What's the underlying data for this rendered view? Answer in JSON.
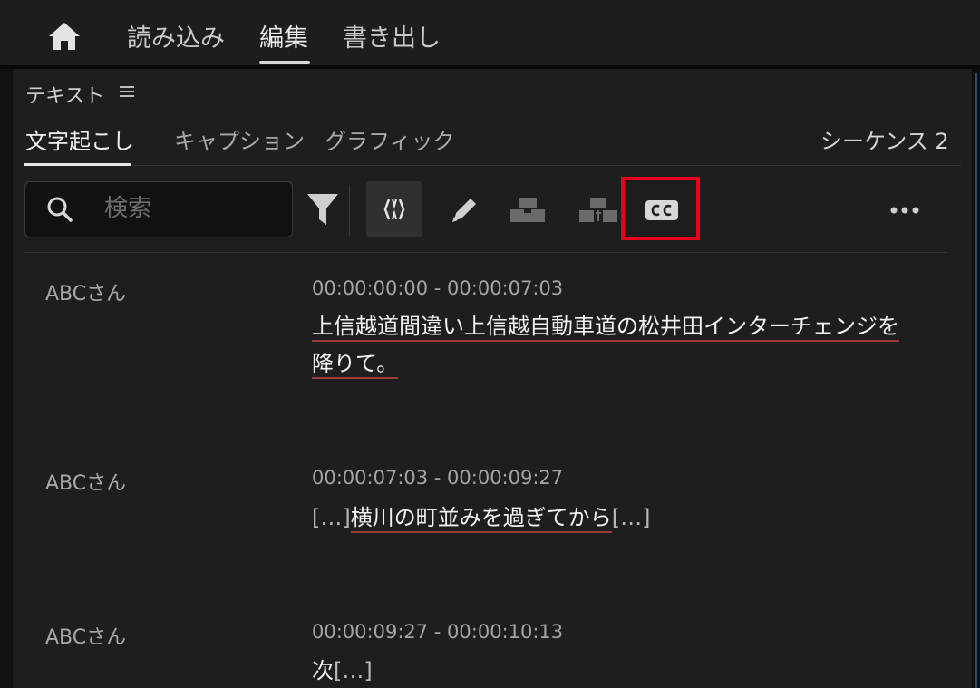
{
  "nav": {
    "home_icon": "home-icon",
    "tabs": [
      {
        "label": "読み込み",
        "active": false
      },
      {
        "label": "編集",
        "active": true
      },
      {
        "label": "書き出し",
        "active": false
      }
    ]
  },
  "panel": {
    "title": "テキスト",
    "menu_icon": "hamburger-icon",
    "tabs": [
      {
        "label": "文字起こし",
        "active": true
      },
      {
        "label": "キャプション",
        "active": false
      },
      {
        "label": "グラフィック",
        "active": false
      }
    ],
    "sequence": "シーケンス 2"
  },
  "toolbar": {
    "search_placeholder": "検索",
    "search_value": "",
    "icons": [
      "search-icon",
      "filter-icon",
      "sync-icon",
      "pencil-icon",
      "merge-icon",
      "split-icon",
      "closed-captions-icon",
      "more-icon"
    ],
    "highlight_color": "#e8001c"
  },
  "transcript": [
    {
      "speaker": "ABCさん",
      "timecode": "00:00:00:00 - 00:00:07:03",
      "line1": "上信越道間違い上信越自動車道の松井田インターチェンジを",
      "line2": "降りて。"
    },
    {
      "speaker": "ABCさん",
      "timecode": "00:00:07:03 - 00:00:09:27",
      "pause_before": "[…]",
      "text": "横川の町並みを過ぎてから",
      "pause_after": "[…]"
    },
    {
      "speaker": "ABCさん",
      "timecode": "00:00:09:27 - 00:00:10:13",
      "text": "次",
      "pause_after": "[…]"
    }
  ],
  "colors": {
    "background": "#1e1e1e",
    "accent": "#e6e6e6",
    "underline": "#9c3b3b"
  }
}
